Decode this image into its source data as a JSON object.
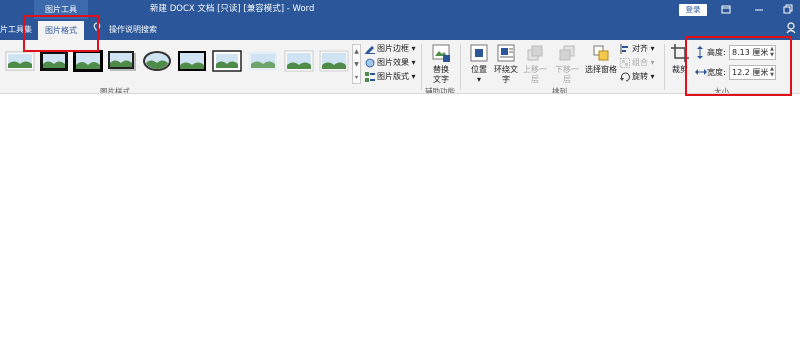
{
  "title_bar": {
    "context_label": "图片工具",
    "document_title": "新建 DOCX 文档 [只读] [兼容模式] - Word",
    "login_button": "登录"
  },
  "tabs": {
    "clipped_left": "片工具集",
    "active": "图片格式",
    "tell_me": "操作说明搜索"
  },
  "ribbon": {
    "picture_styles": {
      "group_label": "图片样式",
      "border_label": "图片边框",
      "effects_label": "图片效果",
      "layout_label": "图片版式"
    },
    "accessibility": {
      "alt_text_label_1": "替换",
      "alt_text_label_2": "文字",
      "group_label": "辅助功能"
    },
    "arrange": {
      "group_label": "排列",
      "position_label": "位置",
      "wrap_label_1": "环绕文",
      "wrap_label_2": "字",
      "forward_label": "上移一层",
      "backward_label": "下移一层",
      "selection_pane_label": "选择窗格",
      "align_label": "对齐",
      "group_obj_label": "组合",
      "rotate_label": "旋转"
    },
    "size": {
      "group_label": "大小",
      "crop_label": "裁剪",
      "height_label": "高度:",
      "height_value": "8.13 厘米",
      "width_label": "宽度:",
      "width_value": "12.2 厘米"
    }
  },
  "colors": {
    "brand_blue": "#2b579a",
    "highlight_red": "#e0101a"
  }
}
